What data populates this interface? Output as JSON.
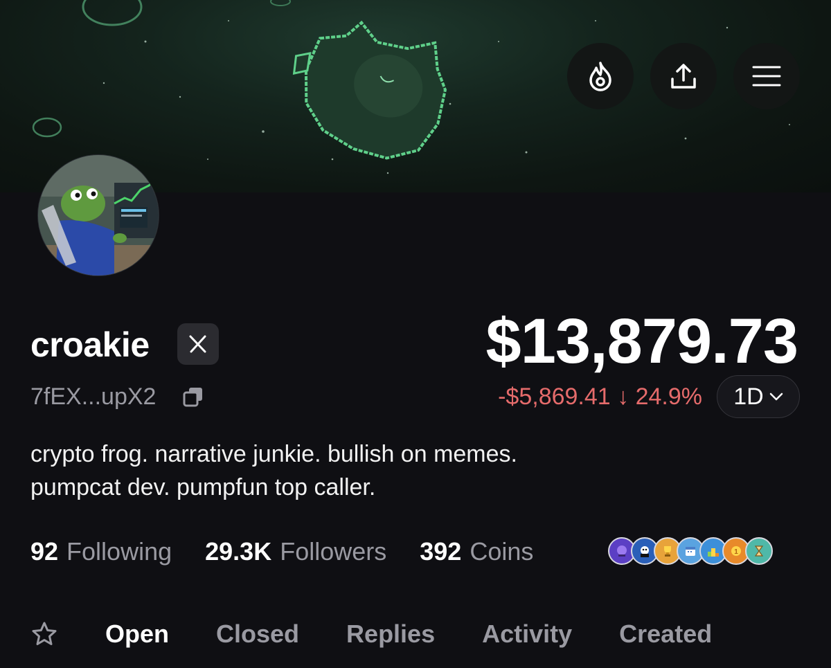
{
  "header": {
    "buttons": [
      {
        "name": "trending",
        "icon": "flame-icon"
      },
      {
        "name": "share",
        "icon": "share-icon"
      },
      {
        "name": "menu",
        "icon": "hamburger-menu-icon"
      }
    ]
  },
  "profile": {
    "username": "croakie",
    "social_badge": "x-logo-icon",
    "address": "7fEX...upX2",
    "bio_lines": [
      "crypto frog. narrative junkie. bullish on memes.",
      "pumpcat dev. pumpfun top caller."
    ]
  },
  "portfolio": {
    "balance": "$13,879.73",
    "change_text": "-$5,869.41 ↓ 24.9%",
    "change_color": "#e56b6b",
    "period": "1D"
  },
  "stats": {
    "following": {
      "value": "92",
      "label": "Following"
    },
    "followers": {
      "value": "29.3K",
      "label": "Followers"
    },
    "coins": {
      "value": "392",
      "label": "Coins"
    }
  },
  "achievement_badges": [
    {
      "icon": "crystal-ball-icon",
      "color": "#5b3fc4"
    },
    {
      "icon": "reaper-icon",
      "color": "#2a5fb8"
    },
    {
      "icon": "trophy-icon",
      "color": "#e8a33a"
    },
    {
      "icon": "calendar-icon",
      "color": "#5aa3e0"
    },
    {
      "icon": "podium-icon",
      "color": "#3c8fd9"
    },
    {
      "icon": "medal-icon",
      "color": "#e88a2a"
    },
    {
      "icon": "hourglass-icon",
      "color": "#4fb8a8"
    }
  ],
  "tabs": [
    "Open",
    "Closed",
    "Replies",
    "Activity",
    "Created"
  ],
  "active_tab": "Open"
}
